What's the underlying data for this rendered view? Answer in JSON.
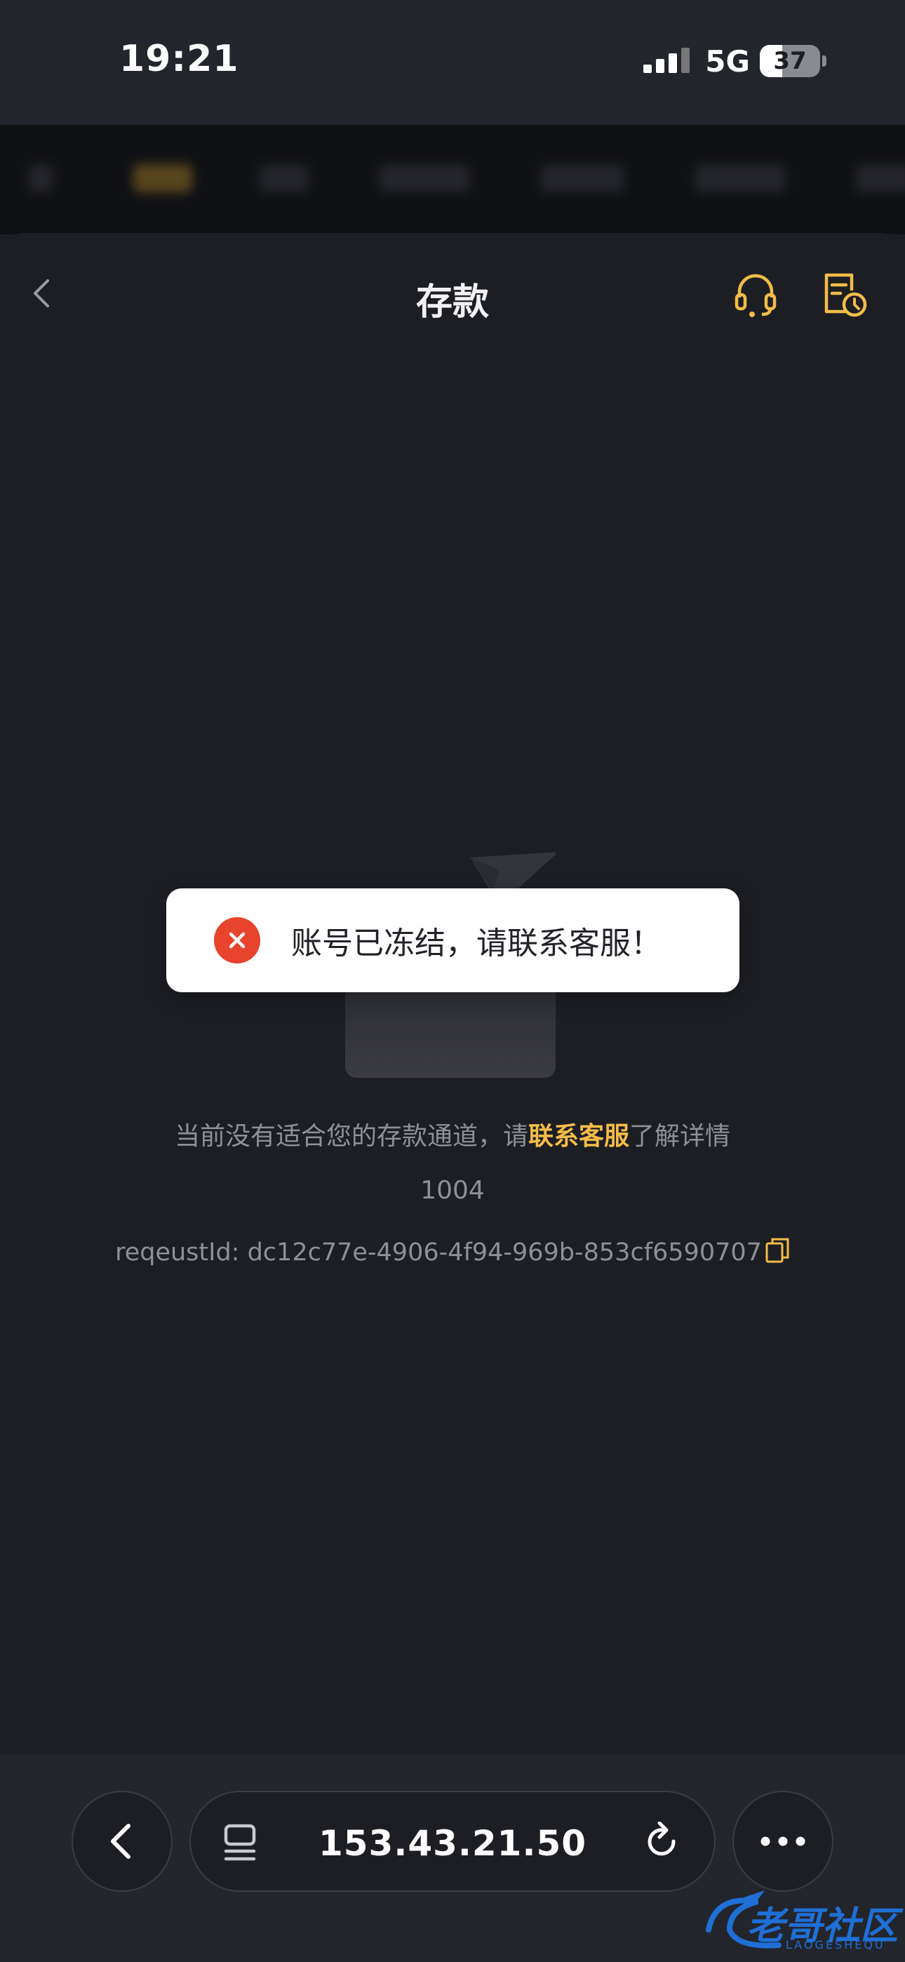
{
  "status_bar": {
    "time": "19:21",
    "network": "5G",
    "battery": "37",
    "battery_level": 0.37
  },
  "header": {
    "title": "存款",
    "back_icon": "chevron-left-icon",
    "support_icon": "headset-icon",
    "history_icon": "document-clock-icon"
  },
  "empty_state": {
    "message_prefix": "当前没有适合您的存款通道，请",
    "message_link": "联系客服",
    "message_suffix": "了解详情",
    "code": "1004",
    "request_id": "reqeustId: dc12c77e-4906-4f94-969b-853cf6590707"
  },
  "toast": {
    "message": "账号已冻结，请联系客服！",
    "icon": "error-x-icon"
  },
  "browser": {
    "url": "153.43.21.50",
    "back_icon": "chevron-left-icon",
    "tabs_icon": "page-list-icon",
    "reload_icon": "reload-icon",
    "more_icon": "more-dots-icon"
  },
  "watermark": {
    "text": "老哥社区",
    "subtext": "LAOGESHEQU"
  },
  "colors": {
    "background": "#1d1e23",
    "accent": "#f2bc49",
    "error": "#e8432d",
    "muted_text": "#8e9098"
  }
}
